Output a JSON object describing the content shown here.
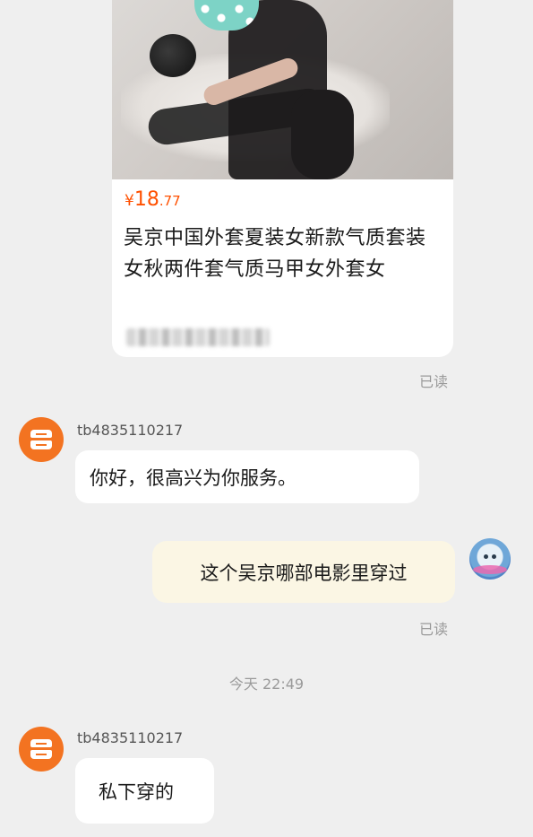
{
  "product": {
    "price_symbol": "¥",
    "price_integer": "18",
    "price_decimal": ".77",
    "title": "吴京中国外套夏装女新款气质套装女秋两件套气质马甲女外套女",
    "read_status": "已读"
  },
  "messages": [
    {
      "sender": "tb4835110217",
      "text": "你好，很高兴为你服务。"
    },
    {
      "text": "这个吴京哪部电影里穿过",
      "read_status": "已读"
    },
    {
      "sender": "tb4835110217",
      "text": "私下穿的"
    }
  ],
  "divider_timestamp": "今天  22:49",
  "colors": {
    "background": "#efefef",
    "price": "#ff5000",
    "shop_avatar": "#f37321",
    "outgoing_bubble": "#fbf6e4",
    "incoming_bubble": "#ffffff"
  },
  "icons": {
    "shop_avatar": "store-icon",
    "user_avatar": "cartoon-avatar-icon"
  }
}
